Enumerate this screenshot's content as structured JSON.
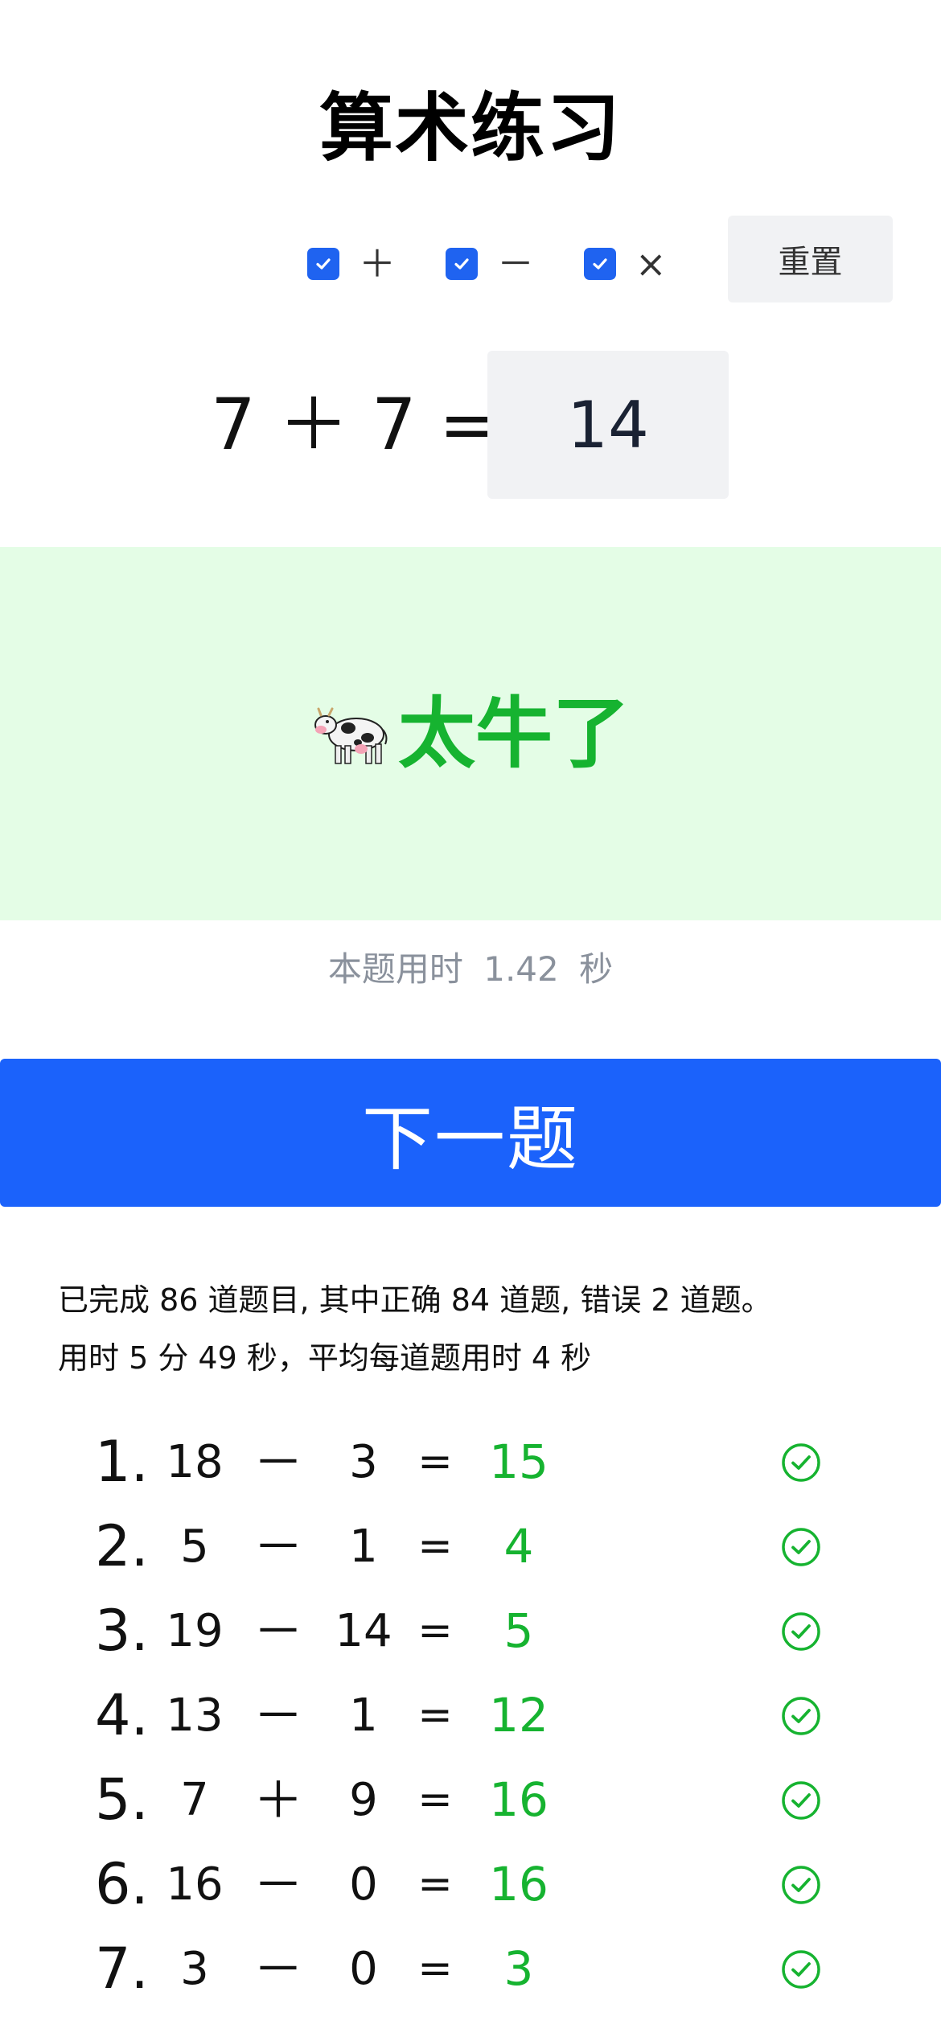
{
  "app": {
    "title": "算术练习"
  },
  "operators": [
    {
      "symbol": "＋",
      "checked": true,
      "icon": "checkbox-checked-icon"
    },
    {
      "symbol": "－",
      "checked": true,
      "icon": "checkbox-checked-icon"
    },
    {
      "symbol": "×",
      "checked": true,
      "icon": "checkbox-checked-icon"
    }
  ],
  "controls": {
    "reset_label": "重置",
    "next_label": "下一题"
  },
  "question": {
    "expression": "7 ＋ 7 =",
    "answer": "14"
  },
  "result": {
    "emoji_icon": "cow-icon",
    "message": "太牛了",
    "color": "#16b330",
    "panel_color": "#e4fde6"
  },
  "timer": {
    "label": "本题用时",
    "value": "1.42",
    "unit": "秒"
  },
  "summary": {
    "line1": "已完成 86 道题目, 其中正确 84 道题, 错误 2 道题。",
    "line2": "用时 5 分 49 秒，平均每道题用时 4 秒"
  },
  "history": [
    {
      "index": "1.",
      "a": "18",
      "op": "－",
      "b": "3",
      "eq": "=",
      "answer": "15",
      "status_icon": "check-circle-icon"
    },
    {
      "index": "2.",
      "a": "5",
      "op": "－",
      "b": "1",
      "eq": "=",
      "answer": "4",
      "status_icon": "check-circle-icon"
    },
    {
      "index": "3.",
      "a": "19",
      "op": "－",
      "b": "14",
      "eq": "=",
      "answer": "5",
      "status_icon": "check-circle-icon"
    },
    {
      "index": "4.",
      "a": "13",
      "op": "－",
      "b": "1",
      "eq": "=",
      "answer": "12",
      "status_icon": "check-circle-icon"
    },
    {
      "index": "5.",
      "a": "7",
      "op": "＋",
      "b": "9",
      "eq": "=",
      "answer": "16",
      "status_icon": "check-circle-icon"
    },
    {
      "index": "6.",
      "a": "16",
      "op": "－",
      "b": "0",
      "eq": "=",
      "answer": "16",
      "status_icon": "check-circle-icon"
    },
    {
      "index": "7.",
      "a": "3",
      "op": "－",
      "b": "0",
      "eq": "=",
      "answer": "3",
      "status_icon": "check-circle-icon"
    }
  ],
  "colors": {
    "accent": "#1b62fb",
    "checkbox": "#1f63f0",
    "correct": "#16b330"
  }
}
